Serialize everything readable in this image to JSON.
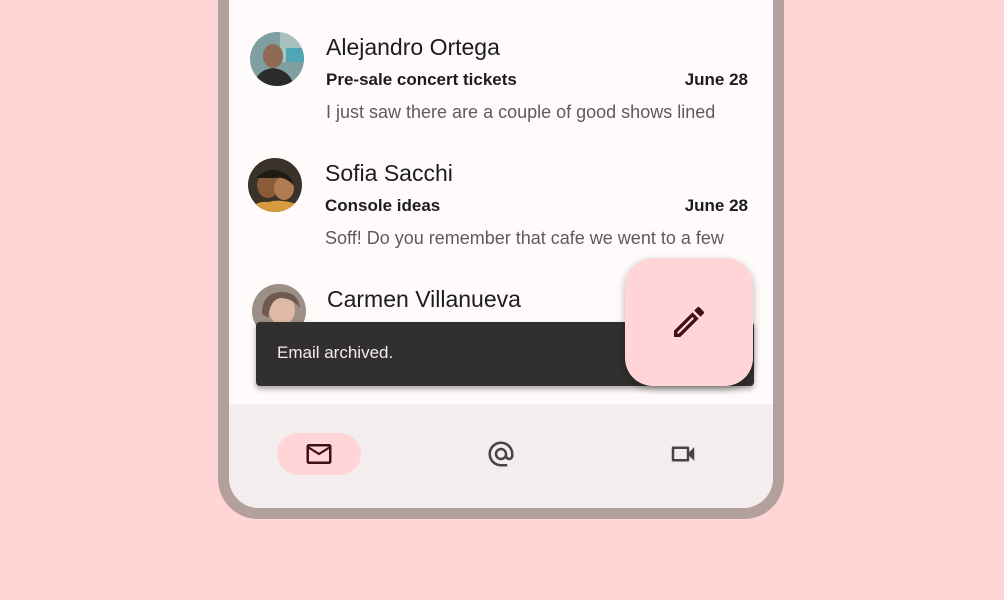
{
  "emails": [
    {
      "sender": "Alejandro Ortega",
      "subject": "Pre-sale concert tickets",
      "date": "June 28",
      "preview": "I just saw there are a couple of good shows lined"
    },
    {
      "sender": "Sofia Sacchi",
      "subject": "Console ideas",
      "date": "June 28",
      "preview": "Soff! Do you remember that cafe we went to a few"
    },
    {
      "sender": "Carmen Villanueva",
      "subject": "",
      "date": "",
      "preview": ""
    }
  ],
  "snackbar": {
    "message": "Email archived."
  },
  "fab": {
    "icon": "edit-icon"
  },
  "bottom_nav": {
    "items": [
      {
        "icon": "mail-icon",
        "active": true
      },
      {
        "icon": "at-sign-icon",
        "active": false
      },
      {
        "icon": "video-icon",
        "active": false
      }
    ]
  },
  "colors": {
    "background": "#FFD5D5",
    "frame": "#B3A09C",
    "surface": "#FFFBFB",
    "nav_surface": "#F3EDED",
    "accent_container": "#FFD5D8",
    "snackbar": "#322F2F",
    "on_accent": "#410E13"
  }
}
